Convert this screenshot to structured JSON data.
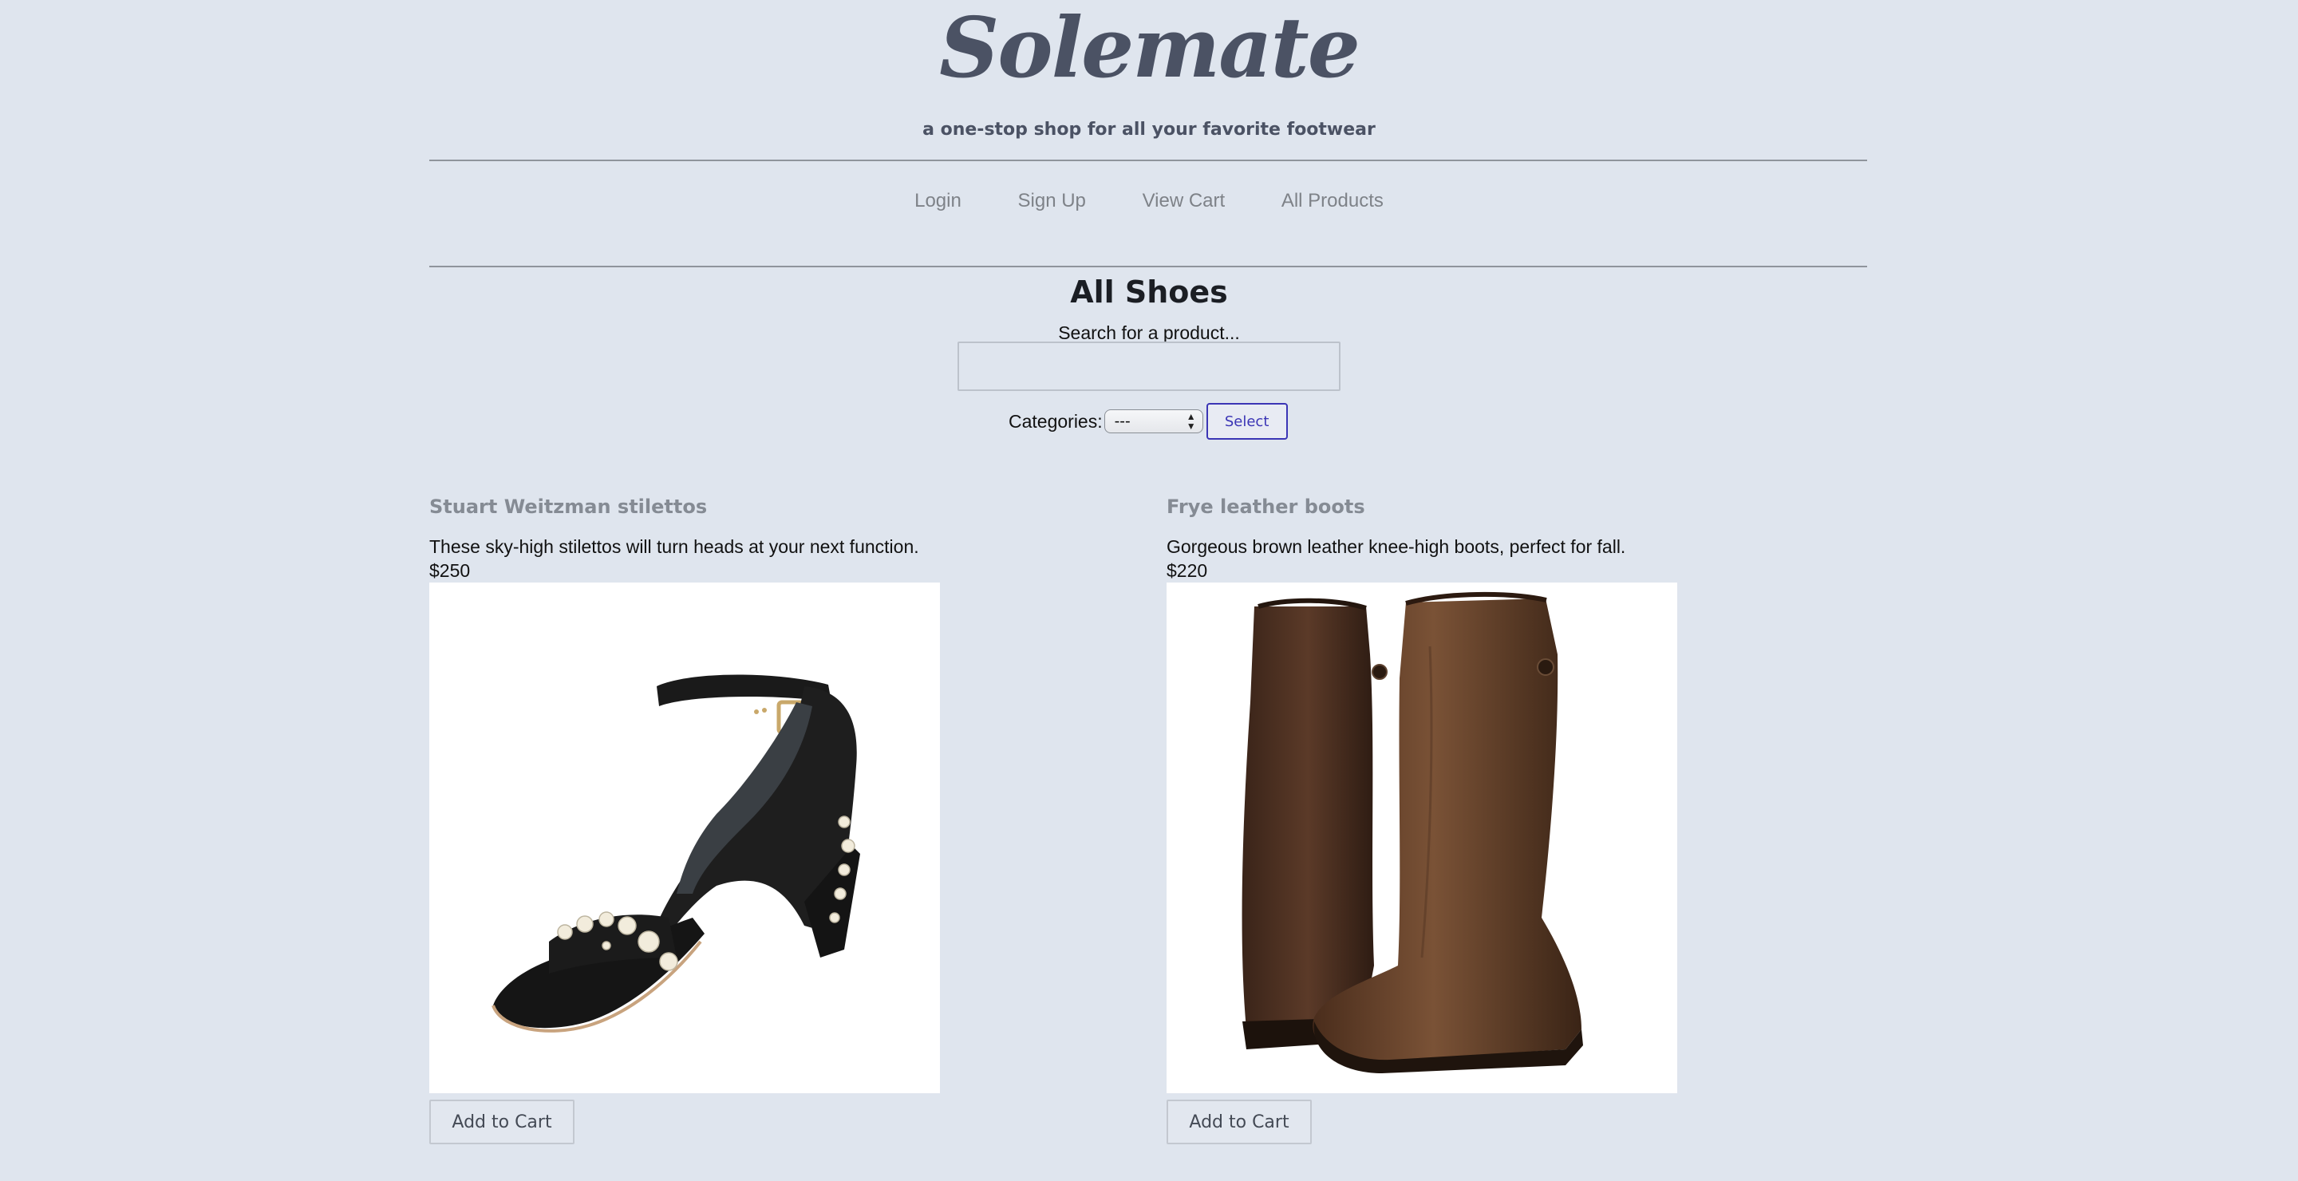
{
  "brand": {
    "logo": "Solemate",
    "tagline": "a one-stop shop for all your favorite footwear"
  },
  "nav": {
    "login": "Login",
    "signup": "Sign Up",
    "view_cart": "View Cart",
    "all_products": "All Products"
  },
  "main": {
    "title": "All Shoes",
    "search_label": "Search for a product...",
    "search_value": "",
    "categories_label": "Categories:",
    "categories_selected": "---",
    "select_button": "Select"
  },
  "products": [
    {
      "name": "Stuart Weitzman stilettos",
      "description": "These sky-high stilettos will turn heads at your next function.",
      "price": "$250",
      "image_icon": "black-heeled-sandal",
      "add_to_cart": "Add to Cart"
    },
    {
      "name": "Frye leather boots",
      "description": "Gorgeous brown leather knee-high boots, perfect for fall.",
      "price": "$220",
      "image_icon": "brown-leather-boots",
      "add_to_cart": "Add to Cart"
    }
  ],
  "colors": {
    "background": "#dfe5ee",
    "logo": "#4b5264",
    "accent_button": "#3b35b5"
  }
}
